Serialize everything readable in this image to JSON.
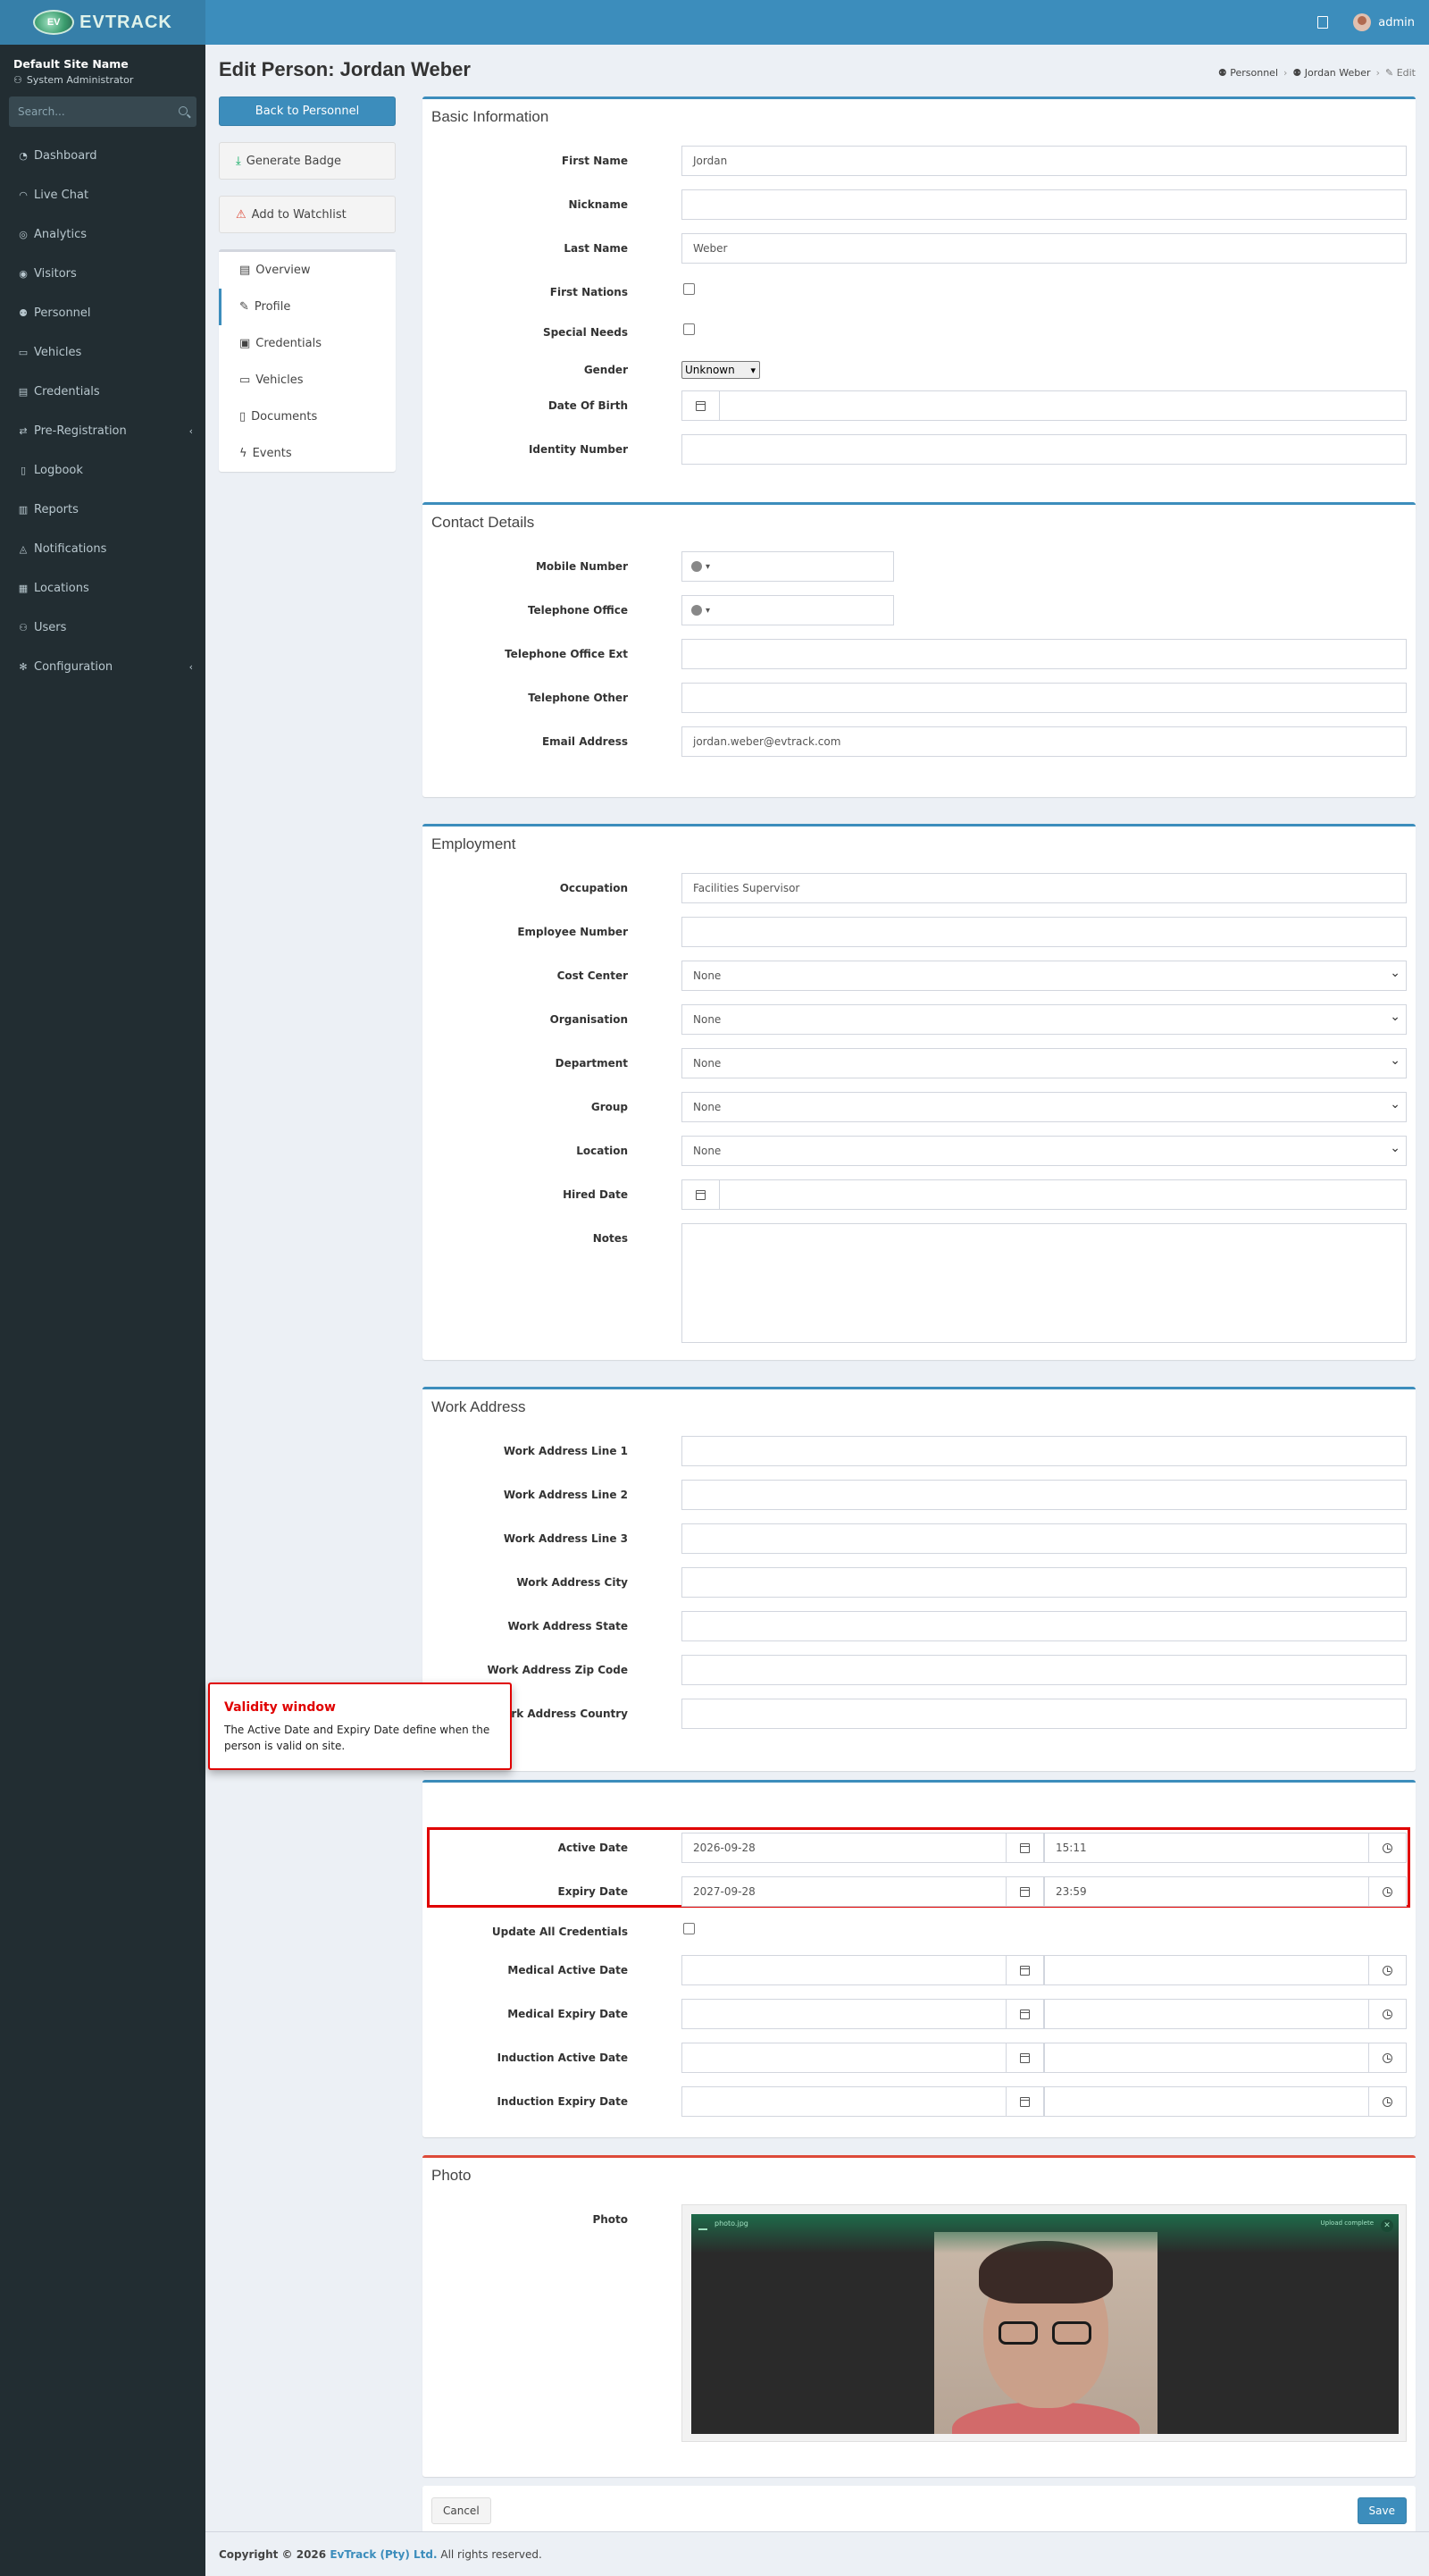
{
  "header": {
    "logo_text": "EVTRACK",
    "logo_ev": "EV",
    "user": "admin"
  },
  "sidebar": {
    "site_name": "Default Site Name",
    "role": "System Administrator",
    "search_placeholder": "Search...",
    "items": [
      {
        "label": "Dashboard",
        "icon": "dashboard-icon"
      },
      {
        "label": "Live Chat",
        "icon": "headset-icon"
      },
      {
        "label": "Analytics",
        "icon": "analytics-icon"
      },
      {
        "label": "Visitors",
        "icon": "eye-icon"
      },
      {
        "label": "Personnel",
        "icon": "users-icon"
      },
      {
        "label": "Vehicles",
        "icon": "car-icon"
      },
      {
        "label": "Credentials",
        "icon": "id-card-icon"
      },
      {
        "label": "Pre-Registration",
        "icon": "arrows-icon"
      },
      {
        "label": "Logbook",
        "icon": "book-icon"
      },
      {
        "label": "Reports",
        "icon": "reports-icon"
      },
      {
        "label": "Notifications",
        "icon": "bell-icon"
      },
      {
        "label": "Locations",
        "icon": "building-icon"
      },
      {
        "label": "Users",
        "icon": "user-group-icon"
      },
      {
        "label": "Configuration",
        "icon": "gear-icon"
      }
    ]
  },
  "page": {
    "title": "Edit Person: Jordan Weber",
    "breadcrumb": [
      "Personnel",
      "Jordan Weber",
      "Edit"
    ]
  },
  "left": {
    "back_button": "Back to Personnel",
    "generate_badge": "Generate Badge",
    "add_watchlist": "Add to Watchlist",
    "menu": [
      "Overview",
      "Profile",
      "Credentials",
      "Vehicles",
      "Documents",
      "Events"
    ]
  },
  "basic": {
    "title": "Basic Information",
    "first_name_label": "First Name",
    "first_name": "Jordan",
    "nickname_label": "Nickname",
    "nickname": "",
    "last_name_label": "Last Name",
    "last_name": "Weber",
    "first_nations_label": "First Nations",
    "special_needs_label": "Special Needs",
    "gender_label": "Gender",
    "gender": "Unknown",
    "dob_label": "Date Of Birth",
    "identity_label": "Identity Number"
  },
  "contact": {
    "title": "Contact Details",
    "mobile_label": "Mobile Number",
    "tel_office_label": "Telephone Office",
    "tel_office_ext_label": "Telephone Office Ext",
    "tel_other_label": "Telephone Other",
    "email_label": "Email Address",
    "email": "jordan.weber@evtrack.com"
  },
  "employment": {
    "title": "Employment",
    "occupation_label": "Occupation",
    "occupation": "Facilities Supervisor",
    "employee_number_label": "Employee Number",
    "cost_center_label": "Cost Center",
    "cost_center": "None",
    "organisation_label": "Organisation",
    "organisation": "None",
    "department_label": "Department",
    "department": "None",
    "group_label": "Group",
    "group": "None",
    "location_label": "Location",
    "location": "None",
    "hired_date_label": "Hired Date",
    "notes_label": "Notes"
  },
  "work_address": {
    "title": "Work Address",
    "line1_label": "Work Address Line 1",
    "line2_label": "Work Address Line 2",
    "line3_label": "Work Address Line 3",
    "city_label": "Work Address City",
    "state_label": "Work Address State",
    "zip_label": "Work Address Zip Code",
    "country_label": "Work Address Country"
  },
  "validity": {
    "active_date_label": "Active Date",
    "active_date": "2026-09-28",
    "active_time": "15:11",
    "expiry_date_label": "Expiry Date",
    "expiry_date": "2027-09-28",
    "expiry_time": "23:59",
    "update_all_label": "Update All Credentials",
    "medical_active_label": "Medical Active Date",
    "medical_expiry_label": "Medical Expiry Date",
    "induction_active_label": "Induction Active Date",
    "induction_expiry_label": "Induction Expiry Date"
  },
  "callout": {
    "title": "Validity window",
    "body": "The Active Date and Expiry Date define when the person is valid on site."
  },
  "photo": {
    "title": "Photo",
    "label": "Photo",
    "file_name": "photo.jpg",
    "status": "Upload complete"
  },
  "actions": {
    "cancel": "Cancel",
    "save": "Save"
  },
  "footer": {
    "copyright": "Copyright © 2026",
    "company": "EvTrack (Pty) Ltd.",
    "rights": "All rights reserved."
  },
  "colors": {
    "primary": "#3c8dbc",
    "sidebar": "#222d32",
    "highlight": "#e00000"
  }
}
